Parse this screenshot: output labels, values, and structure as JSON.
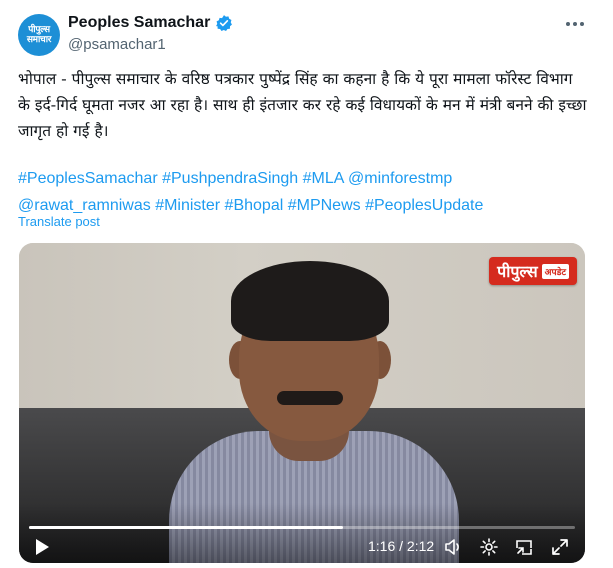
{
  "author": {
    "display_name": "Peoples Samachar",
    "handle": "@psamachar1",
    "avatar_text_line1": "पीपुल्स",
    "avatar_text_line2": "समाचार",
    "verified_color": "#1d9bf0"
  },
  "post": {
    "body": "भोपाल - पीपुल्स समाचार के वरिष्ठ पत्रकार पुष्पेंद्र सिंह का कहना है कि ये पूरा मामला फॉरेस्ट विभाग के इर्द-गिर्द घूमता नजर आ रहा है। साथ ही इंतजार कर रहे कई विधायकों के मन में मंत्री बनने की इच्छा जागृत हो गई है।",
    "tags": [
      "#PeoplesSamachar",
      "#PushpendraSingh",
      "#MLA",
      "@minforestmp",
      "@rawat_ramniwas",
      "#Minister",
      "#Bhopal",
      "#MPNews",
      "#PeoplesUpdate"
    ],
    "translate_label": "Translate post",
    "link_color": "#1d9bf0"
  },
  "video": {
    "watermark_main": "पीपुल्स",
    "watermark_sub": "अपडेट",
    "time_display": "1:16 / 2:12",
    "progress_fraction": 0.575,
    "icons": [
      "play-icon",
      "volume-icon",
      "settings-icon",
      "pip-icon",
      "fullscreen-icon"
    ]
  }
}
